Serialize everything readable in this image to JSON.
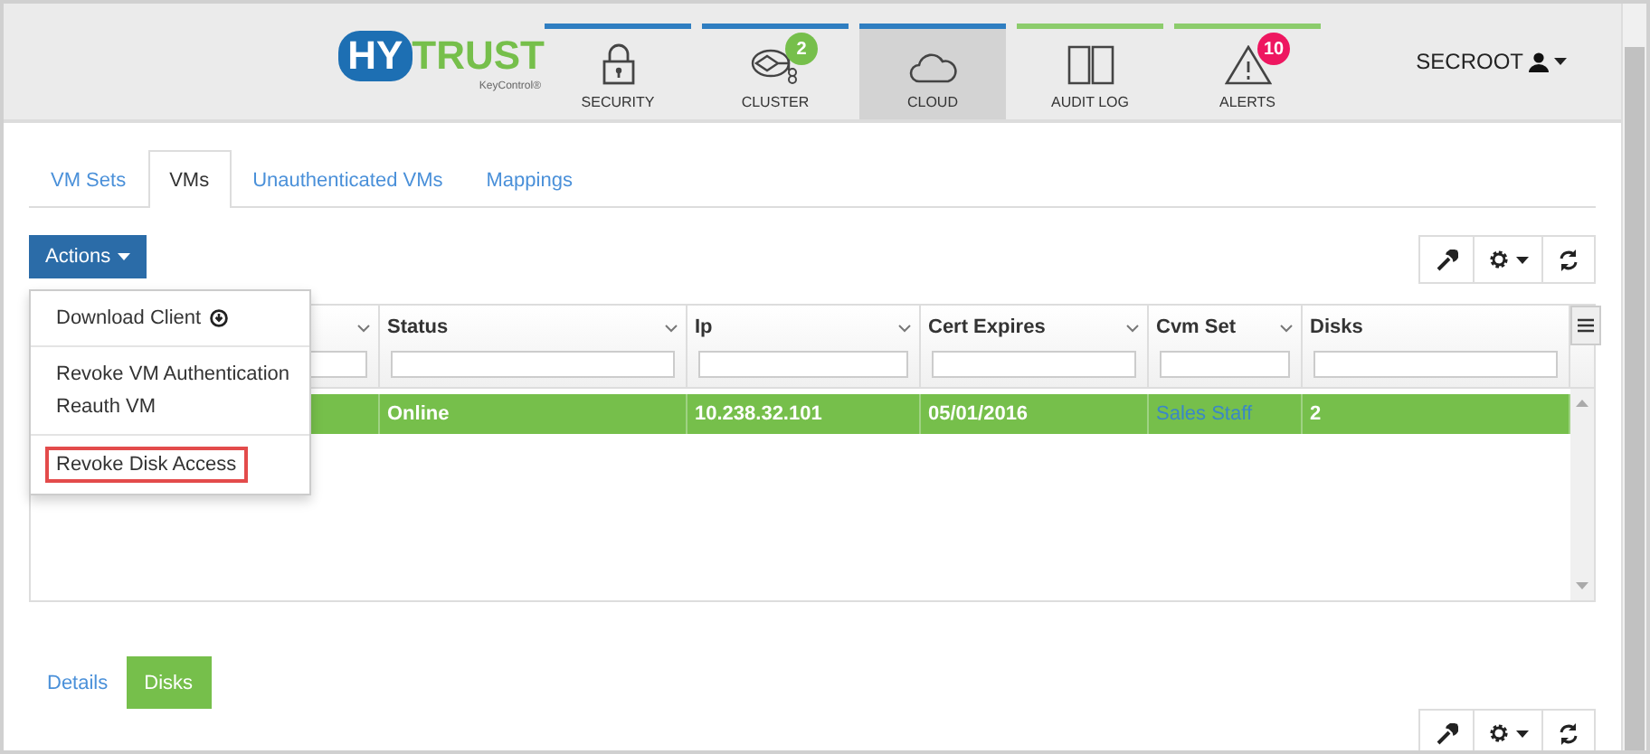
{
  "logo": {
    "first": "HY",
    "second": "TRUST",
    "subtitle": "KeyControl®"
  },
  "nav": [
    {
      "label": "SECURITY",
      "kind": "lock",
      "color": "#2f7ec1",
      "selected": false
    },
    {
      "label": "CLUSTER",
      "kind": "cluster",
      "color": "#2f7ec1",
      "selected": false,
      "badge": "2"
    },
    {
      "label": "CLOUD",
      "kind": "cloud",
      "color": "#2f7ec1",
      "selected": true
    },
    {
      "label": "AUDIT LOG",
      "kind": "book",
      "color": "#8ccc6c",
      "selected": false
    },
    {
      "label": "ALERTS",
      "kind": "warning",
      "color": "#8ccc6c",
      "selected": false,
      "badge": "10"
    }
  ],
  "user": "SECROOT",
  "tabs": [
    {
      "label": "VM Sets",
      "selected": false
    },
    {
      "label": "VMs",
      "selected": true
    },
    {
      "label": "Unauthenticated VMs",
      "selected": false
    },
    {
      "label": "Mappings",
      "selected": false
    }
  ],
  "actions_button": "Actions",
  "menu": [
    [
      {
        "label": "Download Client",
        "kind": "download",
        "highlighted": false
      }
    ],
    [
      {
        "label": "Revoke VM Authentication",
        "kind": "plain",
        "highlighted": false
      },
      {
        "label": "Reauth VM",
        "kind": "plain",
        "highlighted": false
      }
    ],
    [
      {
        "label": "Revoke Disk Access",
        "kind": "plain",
        "highlighted": true
      }
    ]
  ],
  "table": {
    "columns": [
      "",
      "Status",
      "Ip",
      "Cert Expires",
      "Cvm Set",
      "Disks"
    ],
    "rows": [
      {
        "selected": true,
        "cells": [
          {
            "kind": "text",
            "text": ""
          },
          {
            "kind": "text",
            "text": "Online"
          },
          {
            "kind": "text",
            "text": "10.238.32.101"
          },
          {
            "kind": "text",
            "text": "05/01/2016"
          },
          {
            "kind": "link",
            "text": "Sales Staff"
          },
          {
            "kind": "text",
            "text": "2"
          }
        ]
      }
    ]
  },
  "bottom_tabs": [
    {
      "label": "Details",
      "selected": false
    },
    {
      "label": "Disks",
      "selected": true
    }
  ]
}
